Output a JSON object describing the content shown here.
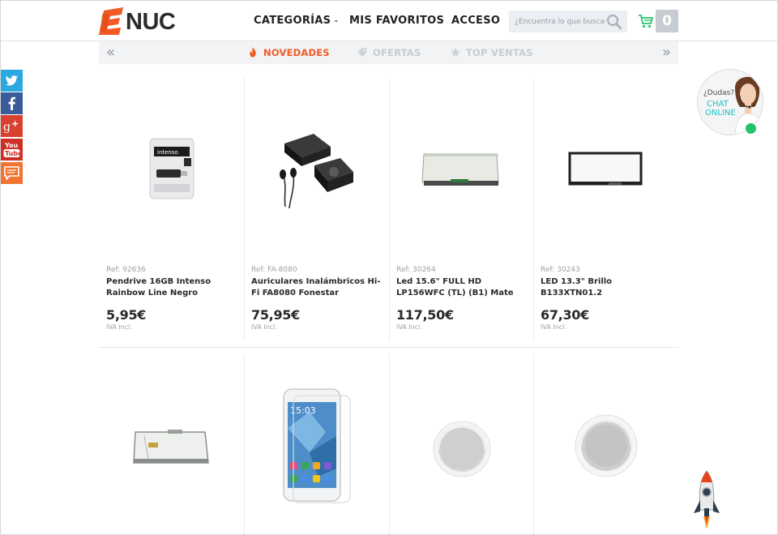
{
  "header": {
    "brand": "NUC",
    "nav": {
      "categorias": "CATEGORÍAS",
      "categorias_caret": "⌄",
      "favoritos": "MIS FAVORITOS",
      "acceso": "ACCESO"
    },
    "search": {
      "placeholder": "¿Encuentra lo que buscas?"
    },
    "cart_count": "0"
  },
  "tabs": {
    "prev": "«",
    "next": "»",
    "items": [
      {
        "label": "NOVEDADES",
        "icon": "fire-icon",
        "active": true
      },
      {
        "label": "OFERTAS",
        "icon": "tag-icon",
        "active": false
      },
      {
        "label": "TOP VENTAS",
        "icon": "star-icon",
        "active": false
      }
    ]
  },
  "social": [
    "twitter-icon",
    "facebook-icon",
    "google-plus-icon",
    "youtube-icon",
    "comment-icon"
  ],
  "products": [
    {
      "ref": "Ref: 92636",
      "name": "Pendrive 16GB Intenso Rainbow Line Negro",
      "price": "5,95€",
      "iva": "IVA Incl.",
      "image": "usb-pendrive"
    },
    {
      "ref": "Ref: FA-8080",
      "name": "Auriculares Inalámbricos Hi-Fi FA8080 Fonestar",
      "price": "75,95€",
      "iva": "IVA Incl.",
      "image": "wireless-earphones"
    },
    {
      "ref": "Ref: 30264",
      "name": "Led 15.6\" FULL HD LP156WFC (TL) (B1) Mate",
      "price": "117,50€",
      "iva": "IVA Incl.",
      "image": "lcd-panel"
    },
    {
      "ref": "Ref: 30243",
      "name": "LED 13.3\" Brillo B133XTN01.2",
      "price": "67,30€",
      "iva": "IVA Incl.",
      "image": "lcd-panel"
    },
    {
      "image": "lcd-panel-back"
    },
    {
      "image": "smartphone",
      "phone_time": "15:03"
    },
    {
      "image": "ceiling-speaker"
    },
    {
      "image": "ceiling-speaker"
    }
  ],
  "chat": {
    "question": "¿Dudas?",
    "line1": "CHAT",
    "line2": "ONLINE"
  },
  "colors": {
    "accent": "#f15a24",
    "chat": "#1ec2c2",
    "online": "#21c26b",
    "cart": "#2cc36b"
  }
}
